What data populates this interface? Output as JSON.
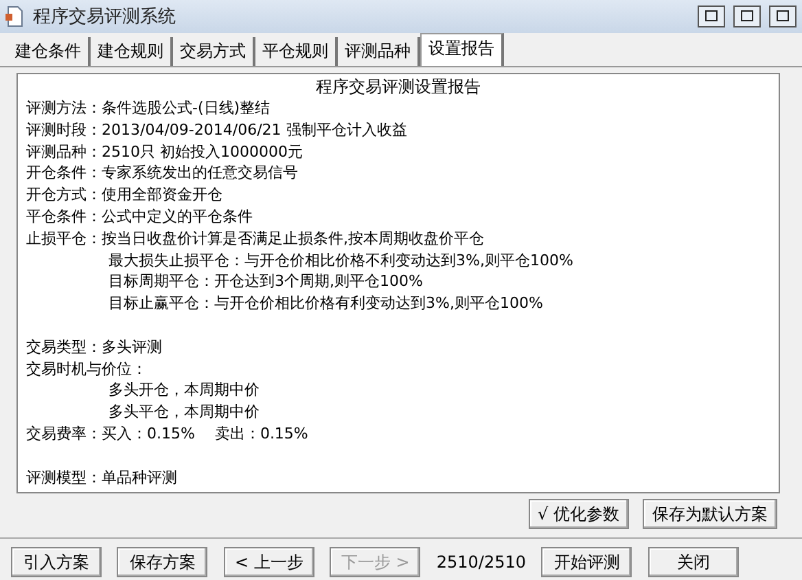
{
  "window": {
    "title": "程序交易评测系统"
  },
  "tabs": [
    {
      "label": "建仓条件",
      "selected": false
    },
    {
      "label": "建仓规则",
      "selected": false
    },
    {
      "label": "交易方式",
      "selected": false
    },
    {
      "label": "平仓规则",
      "selected": false
    },
    {
      "label": "评测品种",
      "selected": false
    },
    {
      "label": "设置报告",
      "selected": true
    }
  ],
  "report": {
    "heading": "程序交易评测设置报告",
    "lines": [
      {
        "kind": "field",
        "label": "评测方法：",
        "value": "条件选股公式-(日线)整结"
      },
      {
        "kind": "field",
        "label": "评测时段：",
        "value": "2013/04/09-2014/06/21 强制平仓计入收益"
      },
      {
        "kind": "field",
        "label": "评测品种：",
        "value": "2510只 初始投入1000000元"
      },
      {
        "kind": "field",
        "label": "开仓条件：",
        "value": "专家系统发出的任意交易信号"
      },
      {
        "kind": "field",
        "label": "开仓方式：",
        "value": "使用全部资金开仓"
      },
      {
        "kind": "field",
        "label": "平仓条件：",
        "value": "公式中定义的平仓条件"
      },
      {
        "kind": "field",
        "label": "止损平仓：",
        "value": "按当日收盘价计算是否满足止损条件,按本周期收盘价平仓"
      },
      {
        "kind": "sub",
        "value": "最大损失止损平仓：与开仓价相比价格不利变动达到3%,则平仓100%"
      },
      {
        "kind": "sub",
        "value": "目标周期平仓：开仓达到3个周期,则平仓100%"
      },
      {
        "kind": "sub",
        "value": "目标止赢平仓：与开仓价相比价格有利变动达到3%,则平仓100%"
      },
      {
        "kind": "blank"
      },
      {
        "kind": "field",
        "label": "交易类型：",
        "value": "多头评测"
      },
      {
        "kind": "field",
        "label": "交易时机与价位："
      },
      {
        "kind": "sub",
        "value": "多头开仓，本周期中价"
      },
      {
        "kind": "sub",
        "value": "多头平仓，本周期中价"
      },
      {
        "kind": "field",
        "label": "交易费率：",
        "value": "买入：0.15%　 卖出：0.15%"
      },
      {
        "kind": "blank"
      },
      {
        "kind": "field",
        "label": "评测模型：",
        "value": "单品种评测"
      }
    ]
  },
  "side_buttons": [
    {
      "icon": "√",
      "label": "优化参数"
    },
    {
      "label": "保存为默认方案"
    }
  ],
  "footer": [
    {
      "kind": "button",
      "label": "引入方案",
      "disabled": false
    },
    {
      "kind": "button",
      "label": "保存方案",
      "disabled": false
    },
    {
      "kind": "button",
      "label": "< 上一步",
      "disabled": false
    },
    {
      "kind": "button",
      "label": "下一步 >",
      "disabled": true
    },
    {
      "kind": "text",
      "label": "2510/2510"
    },
    {
      "kind": "button",
      "label": "开始评测",
      "disabled": false
    },
    {
      "kind": "button",
      "label": "关闭",
      "disabled": false
    }
  ]
}
